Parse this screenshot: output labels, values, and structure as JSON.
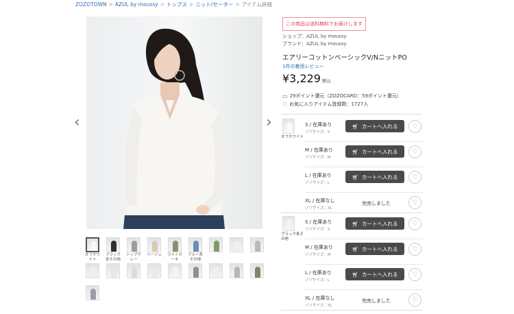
{
  "breadcrumb": [
    "ZOZOTOWN",
    "AZUL by moussy",
    "トップス",
    "ニット/セーター",
    "アイテム詳細"
  ],
  "product": {
    "shipping_notice": "この商品は送料無料でお届けします",
    "shop": "ショップ：AZUL by moussy",
    "brand": "ブランド：AZUL by moussy",
    "title": "エアリーコットンベーシックV/NニットPO",
    "review_link": "1件の着用レビュー",
    "price": "¥3,229",
    "tax_label": "税込",
    "points": "29ポイント還元（ZOZOCARD：59ポイント還元）",
    "favorites": "お気に入りアイテム登録数：1727人"
  },
  "thumbnails": [
    {
      "caption": "オフホワイト",
      "color": "#f7f7f5"
    },
    {
      "caption": "ブラック\n系その他",
      "color": "#2f3033"
    },
    {
      "caption": "トップグ\nレー",
      "color": "#9a9c9f"
    },
    {
      "caption": "ベージュ",
      "color": "#d9cbb2"
    },
    {
      "caption": "ライトカ\nーキ",
      "color": "#8c8f6e"
    },
    {
      "caption": "ブルー系\nその他",
      "color": "#6f8db0"
    },
    {
      "caption": "",
      "color": "#7e9a6a"
    },
    {
      "caption": "",
      "color": "#f1efe9"
    },
    {
      "caption": "",
      "color": "#b7b9bb"
    },
    {
      "caption": "",
      "color": "#f3eee8"
    },
    {
      "caption": "",
      "color": "#ece6dd"
    },
    {
      "caption": "",
      "color": "#dcdcdc"
    },
    {
      "caption": "",
      "color": "#e9e9e9"
    },
    {
      "caption": "",
      "color": "#f4f4f4"
    },
    {
      "caption": "",
      "color": "#8e9194"
    },
    {
      "caption": "",
      "color": "#f0f0f0"
    },
    {
      "caption": "",
      "color": "#b9b6ab"
    },
    {
      "caption": "",
      "color": "#7d8567"
    },
    {
      "caption": "",
      "color": "#9aa0a6"
    }
  ],
  "colors": [
    {
      "name": "オフホワイト",
      "sizes": [
        {
          "stock": "S / 在庫あり",
          "size": "ゾゾサイズ：S",
          "available": true
        },
        {
          "stock": "M / 在庫あり",
          "size": "ゾゾサイズ：M",
          "available": true
        },
        {
          "stock": "L / 在庫あり",
          "size": "ゾゾサイズ：L",
          "available": true
        },
        {
          "stock": "XL / 在庫なし",
          "size": "ゾゾサイズ：XL",
          "available": false
        }
      ]
    },
    {
      "name": "ブラック系そ\nの他",
      "sizes": [
        {
          "stock": "S / 在庫あり",
          "size": "ゾゾサイズ：S",
          "available": true
        },
        {
          "stock": "M / 在庫あり",
          "size": "ゾゾサイズ：M",
          "available": true
        },
        {
          "stock": "L / 在庫あり",
          "size": "ゾゾサイズ：L",
          "available": true
        },
        {
          "stock": "XL / 在庫なし",
          "size": "ゾゾサイズ：XL",
          "available": false
        }
      ]
    }
  ],
  "labels": {
    "add_to_cart": "カートへ入れる",
    "sold_out": "完売しました"
  }
}
